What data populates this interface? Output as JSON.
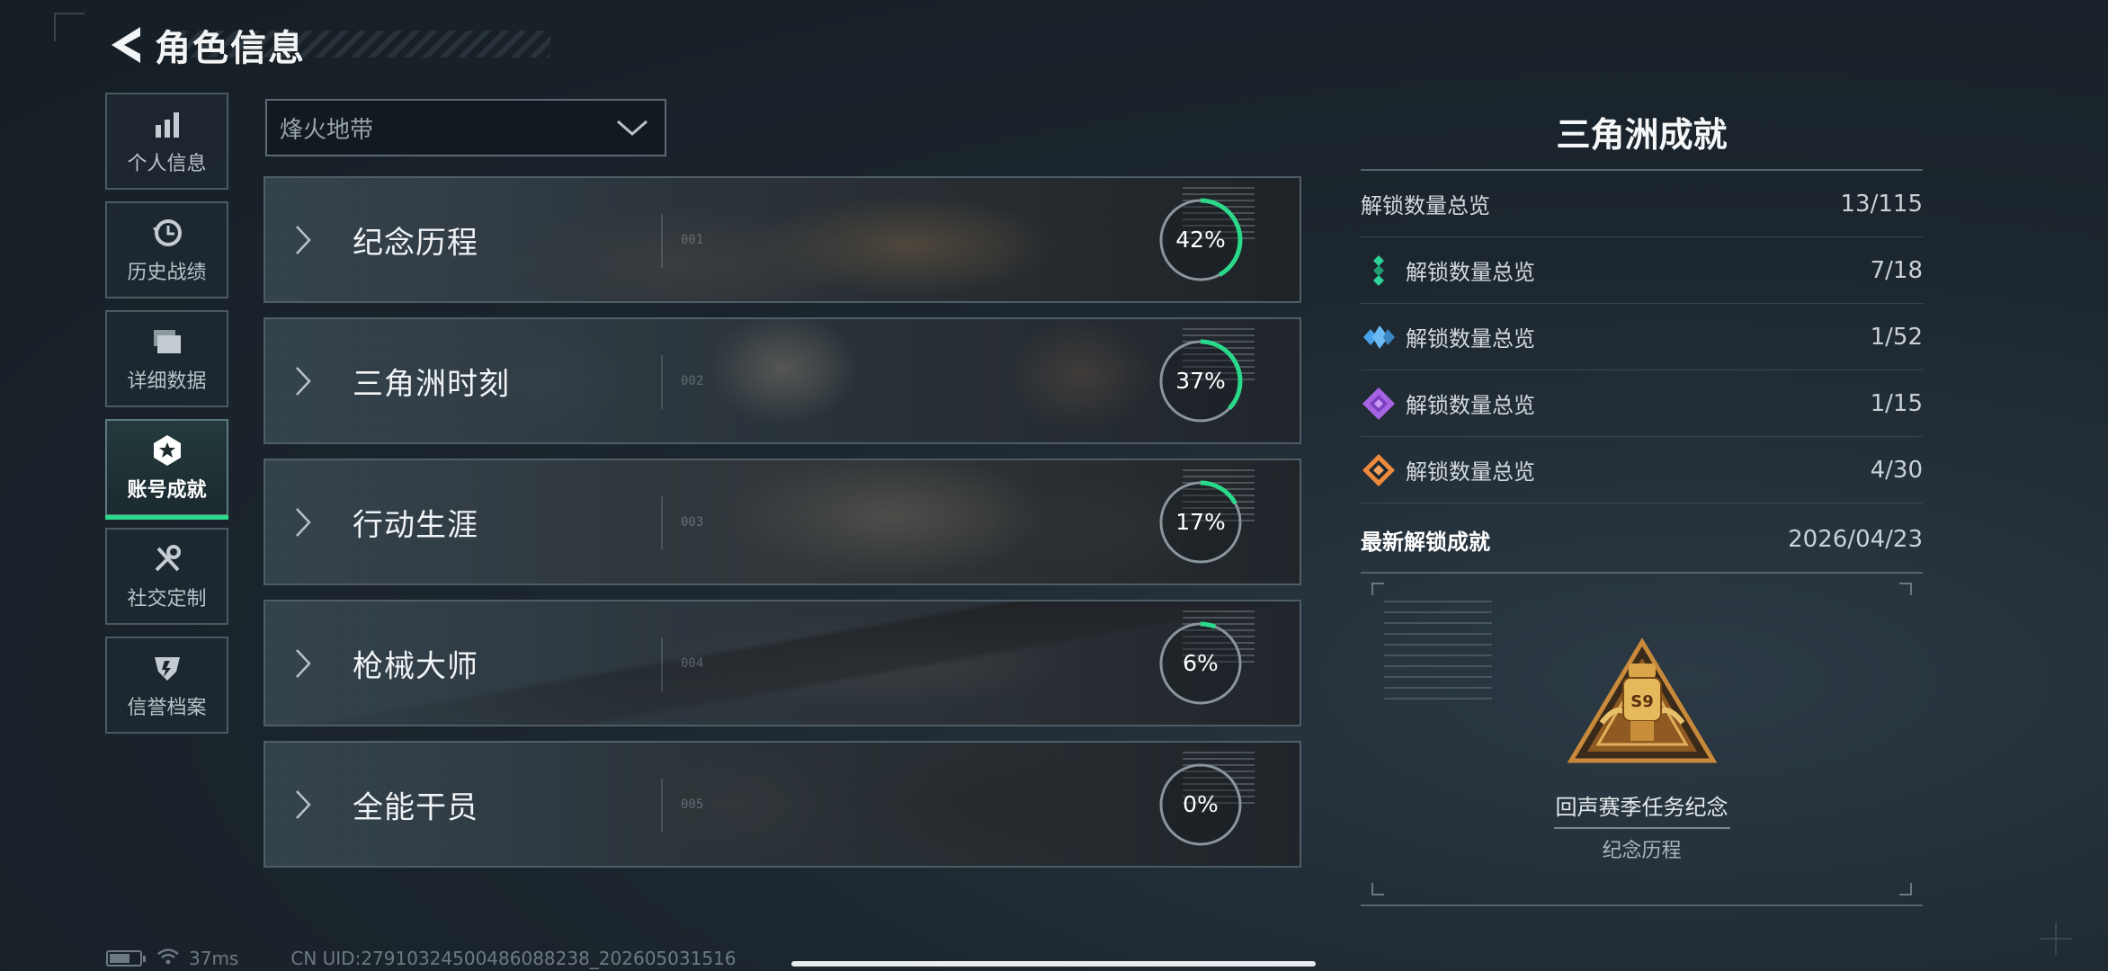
{
  "header": {
    "title": "角色信息"
  },
  "sidebar": {
    "items": [
      {
        "label": "个人信息",
        "icon": "bar-chart-icon"
      },
      {
        "label": "历史战绩",
        "icon": "history-clock-icon"
      },
      {
        "label": "详细数据",
        "icon": "folder-icon"
      },
      {
        "label": "账号成就",
        "icon": "achievement-medal-icon",
        "active": true
      },
      {
        "label": "社交定制",
        "icon": "tools-icon"
      },
      {
        "label": "信誉档案",
        "icon": "credit-shield-icon"
      }
    ]
  },
  "mode_selector": {
    "value": "烽火地带"
  },
  "categories": [
    {
      "name": "纪念历程",
      "index": "001",
      "progress": 42,
      "progress_label": "42%"
    },
    {
      "name": "三角洲时刻",
      "index": "002",
      "progress": 37,
      "progress_label": "37%"
    },
    {
      "name": "行动生涯",
      "index": "003",
      "progress": 17,
      "progress_label": "17%"
    },
    {
      "name": "枪械大师",
      "index": "004",
      "progress": 6,
      "progress_label": "6%"
    },
    {
      "name": "全能干员",
      "index": "005",
      "progress": 0,
      "progress_label": "0%"
    }
  ],
  "summary": {
    "title": "三角洲成就",
    "total": {
      "label": "解锁数量总览",
      "value": "13/115"
    },
    "tiers": [
      {
        "label": "解锁数量总览",
        "value": "7/18",
        "color": "#2ed39a"
      },
      {
        "label": "解锁数量总览",
        "value": "1/52",
        "color": "#4aa3e8"
      },
      {
        "label": "解锁数量总览",
        "value": "1/15",
        "color": "#a765e6"
      },
      {
        "label": "解锁数量总览",
        "value": "4/30",
        "color": "#ef8a3c"
      }
    ],
    "latest": {
      "label": "最新解锁成就",
      "date": "2026/04/23",
      "achievement_name": "回声赛季任务纪念",
      "achievement_category": "纪念历程",
      "badge_number": "S9"
    }
  },
  "status_bar": {
    "ping": "37ms",
    "uid": "CN UID:27910324500486088238_202605031516"
  },
  "colors": {
    "accent": "#2bd98a",
    "ring_track": "#8a959c"
  }
}
